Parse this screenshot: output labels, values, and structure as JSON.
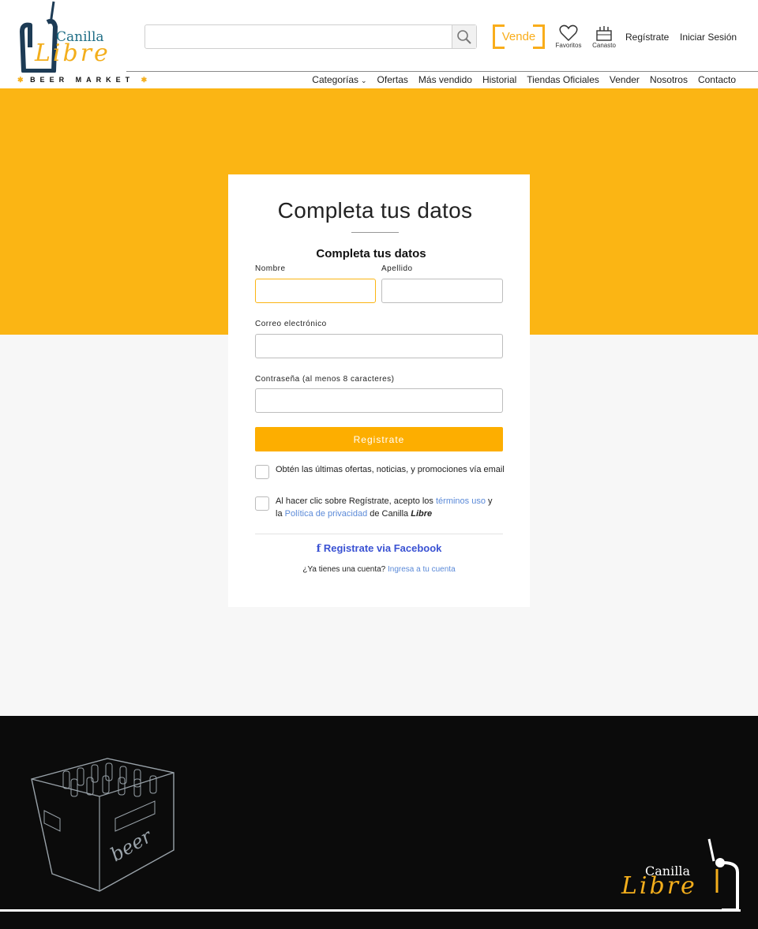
{
  "brand": {
    "name_top": "Canilla",
    "name_script": "Libre",
    "tagline": "BEER MARKET",
    "accent": "#fbb514"
  },
  "header": {
    "search": {
      "placeholder": "",
      "icon": "search-icon"
    },
    "vende_label": "Vende",
    "favoritos_label": "Favoritos",
    "canasto_label": "Canasto",
    "register_label": "Regístrate",
    "login_label": "Iniciar Sesión"
  },
  "nav": {
    "items": [
      "Categorías",
      "Ofertas",
      "Más vendido",
      "Historial",
      "Tiendas Oficiales",
      "Vender",
      "Nosotros",
      "Contacto"
    ]
  },
  "form": {
    "title": "Completa tus datos",
    "subtitle": "Completa tus datos",
    "first_name_label": "Nombre",
    "last_name_label": "Apellido",
    "email_label": "Correo electrónico",
    "password_label": "Contraseña (al menos 8 caracteres)",
    "submit_label": "Registrate",
    "newsletter_text": "Obtén las últimas ofertas, noticias, y promociones vía email",
    "terms_prefix": "Al hacer clic sobre Regístrate, acepto los ",
    "terms_link": "términos uso",
    "terms_mid": " y la ",
    "privacy_link": "Política de privacidad",
    "terms_suffix": " de Canilla ",
    "terms_brand": "Libre",
    "facebook_label": "Registrate via Facebook",
    "have_account": "¿Ya tienes una cuenta? ",
    "login_link": "Ingresa a tu cuenta"
  },
  "footer": {
    "crate_script": "beer",
    "brand_top": "Canilla",
    "brand_script": "Libre"
  }
}
